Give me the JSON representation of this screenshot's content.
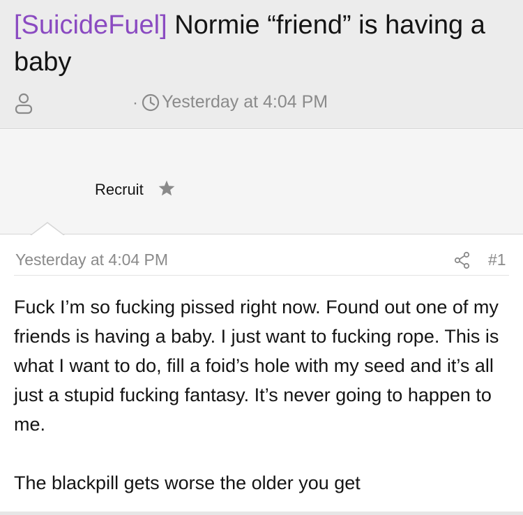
{
  "thread": {
    "prefix": "[SuicideFuel]",
    "title": "Normie “friend” is having a baby",
    "date": "Yesterday at 4:04 PM",
    "separator": "·"
  },
  "user": {
    "title": "Recruit"
  },
  "post": {
    "date": "Yesterday at 4:04 PM",
    "number": "#1",
    "body_paragraph_1": "Fuck I’m so fucking pissed right now. Found out one of my friends is having a baby. I just want to fucking rope. This is what I want to do, fill a foid’s hole with my seed and it’s all just a stupid fucking fantasy. It’s never going to happen to me.",
    "body_paragraph_2": "The blackpill gets worse the older you get"
  },
  "icons": {
    "user": "user-icon",
    "clock": "clock-icon",
    "star": "star-icon",
    "share": "share-icon"
  },
  "colors": {
    "prefix": "#8a4ac1",
    "header_bg": "#ececec",
    "user_block_bg": "#f5f5f5",
    "muted_text": "#8a8a8a"
  }
}
